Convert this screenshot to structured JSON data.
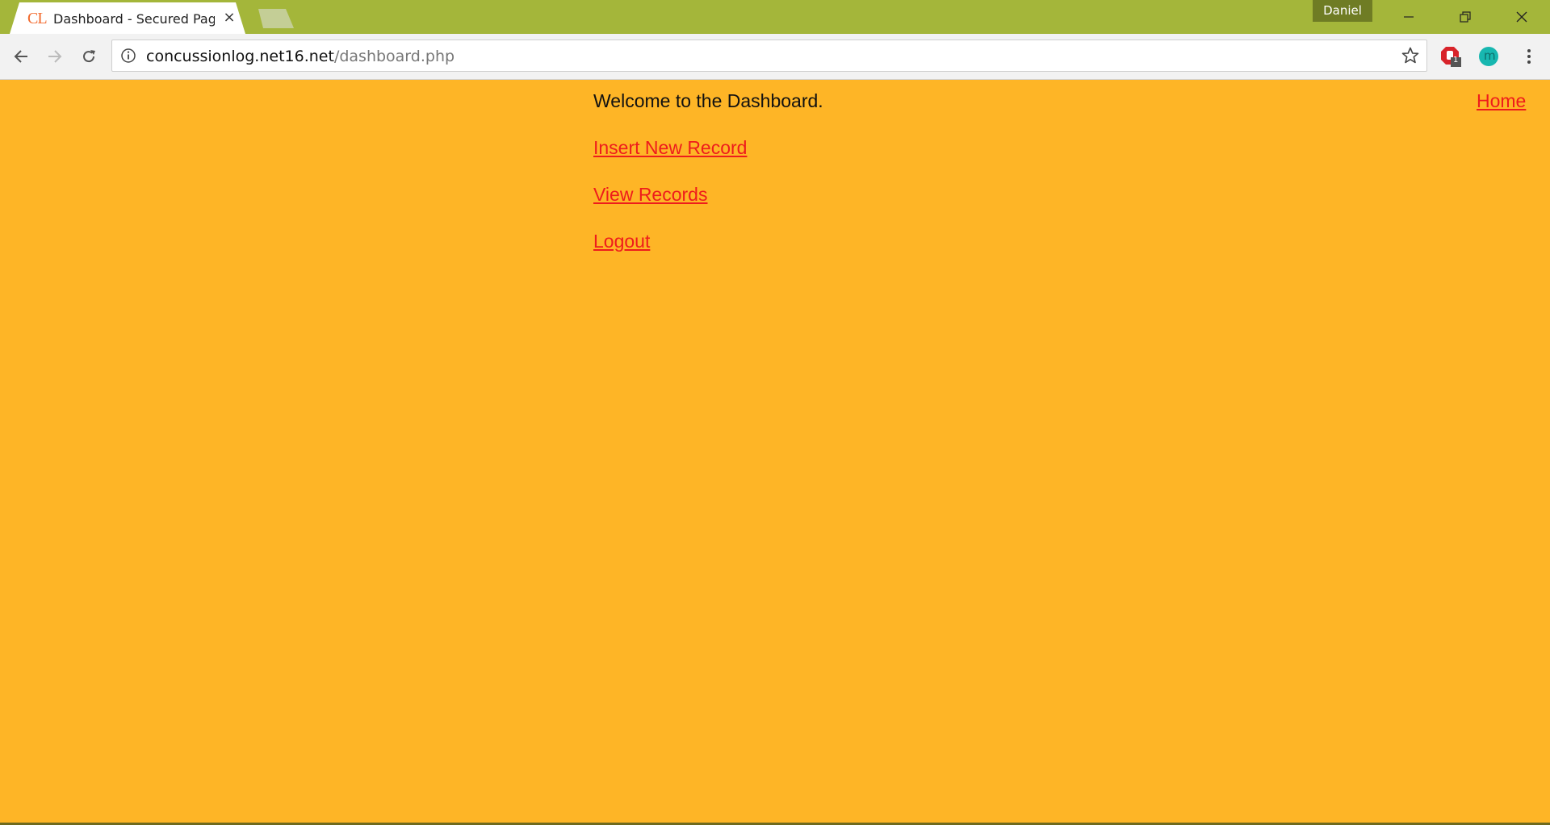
{
  "browser": {
    "tab_title": "Dashboard - Secured Page",
    "tab_favicon_text": "CL",
    "tab_close_symbol": "×",
    "profile_name": "Daniel",
    "url_host": "concussionlog.net16.net",
    "url_path": "/dashboard.php",
    "extension_badge": "1",
    "extension_letter": "m",
    "colors": {
      "titlebar": "#A4B63A",
      "page_background": "#FEB526",
      "link": "#EE1C1C"
    }
  },
  "page": {
    "welcome_text": "Welcome to the Dashboard.",
    "home_link": "Home",
    "links": {
      "insert": "Insert New Record",
      "view": "View Records",
      "logout": "Logout"
    }
  }
}
